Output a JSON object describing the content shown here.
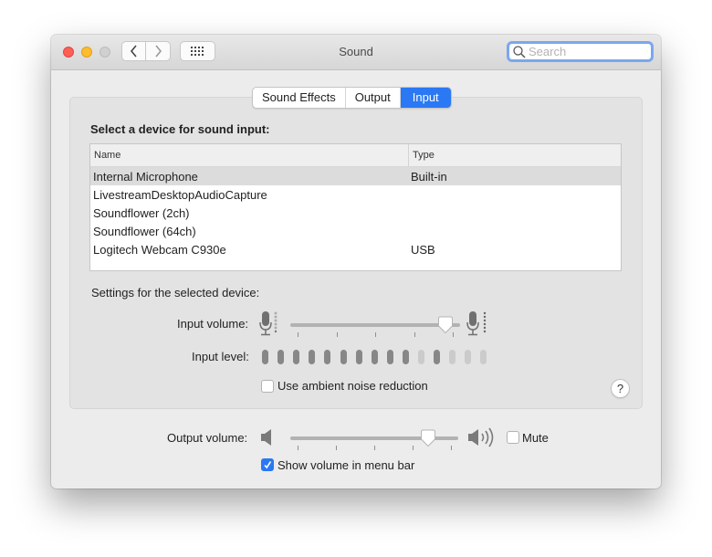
{
  "window": {
    "title": "Sound",
    "search_placeholder": "Search",
    "search_value": ""
  },
  "tabs": [
    {
      "label": "Sound Effects",
      "active": false
    },
    {
      "label": "Output",
      "active": false
    },
    {
      "label": "Input",
      "active": true
    }
  ],
  "input_panel": {
    "section_title": "Select a device for sound input:",
    "table": {
      "columns": [
        "Name",
        "Type"
      ],
      "rows": [
        {
          "name": "Internal Microphone",
          "type": "Built-in",
          "selected": true
        },
        {
          "name": "LivestreamDesktopAudioCapture",
          "type": "",
          "selected": false
        },
        {
          "name": "Soundflower (2ch)",
          "type": "",
          "selected": false
        },
        {
          "name": "Soundflower (64ch)",
          "type": "",
          "selected": false
        },
        {
          "name": "Logitech Webcam C930e",
          "type": "USB",
          "selected": false
        }
      ]
    },
    "settings_label": "Settings for the selected device:",
    "input_volume_label": "Input volume:",
    "input_volume_fraction": 0.95,
    "input_level_label": "Input level:",
    "input_level_segments": [
      1,
      1,
      1,
      1,
      1,
      1,
      1,
      1,
      1,
      1,
      0,
      1,
      0,
      0,
      0
    ],
    "noise_reduction_label": "Use ambient noise reduction",
    "noise_reduction_checked": false,
    "help_label": "?"
  },
  "output": {
    "volume_label": "Output volume:",
    "volume_fraction": 0.85,
    "mute_label": "Mute",
    "mute_checked": false,
    "show_volume_label": "Show volume in menu bar",
    "show_volume_checked": true
  },
  "colors": {
    "accent": "#2a78f4",
    "level_on": "#878787",
    "level_off": "#cbcbcb",
    "focus_ring": "#7aa7ee"
  }
}
